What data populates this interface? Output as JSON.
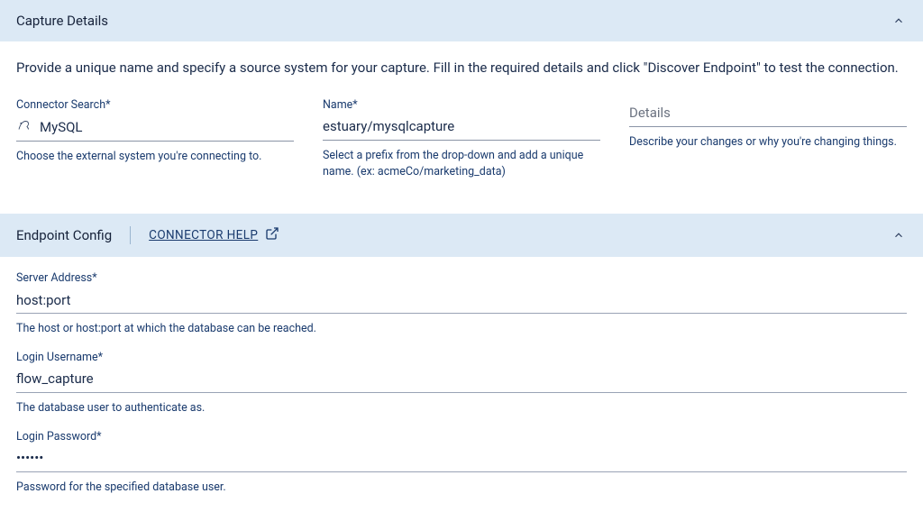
{
  "captureDetails": {
    "title": "Capture Details",
    "intro": "Provide a unique name and specify a source system for your capture. Fill in the required details and click \"Discover Endpoint\" to test the connection.",
    "connectorSearch": {
      "label": "Connector Search*",
      "value": "MySQL",
      "help": "Choose the external system you're connecting to."
    },
    "name": {
      "label": "Name*",
      "value": "estuary/mysqlcapture",
      "help": "Select a prefix from the drop-down and add a unique name. (ex: acmeCo/marketing_data)"
    },
    "details": {
      "label": "",
      "placeholder": "Details",
      "value": "",
      "help": "Describe your changes or why you're changing things."
    }
  },
  "endpointConfig": {
    "title": "Endpoint Config",
    "helpLink": "CONNECTOR HELP",
    "serverAddress": {
      "label": "Server Address*",
      "value": "host:port",
      "help": "The host or host:port at which the database can be reached."
    },
    "loginUsername": {
      "label": "Login Username*",
      "value": "flow_capture",
      "help": "The database user to authenticate as."
    },
    "loginPassword": {
      "label": "Login Password*",
      "value": "••••••",
      "help": "Password for the specified database user."
    }
  }
}
